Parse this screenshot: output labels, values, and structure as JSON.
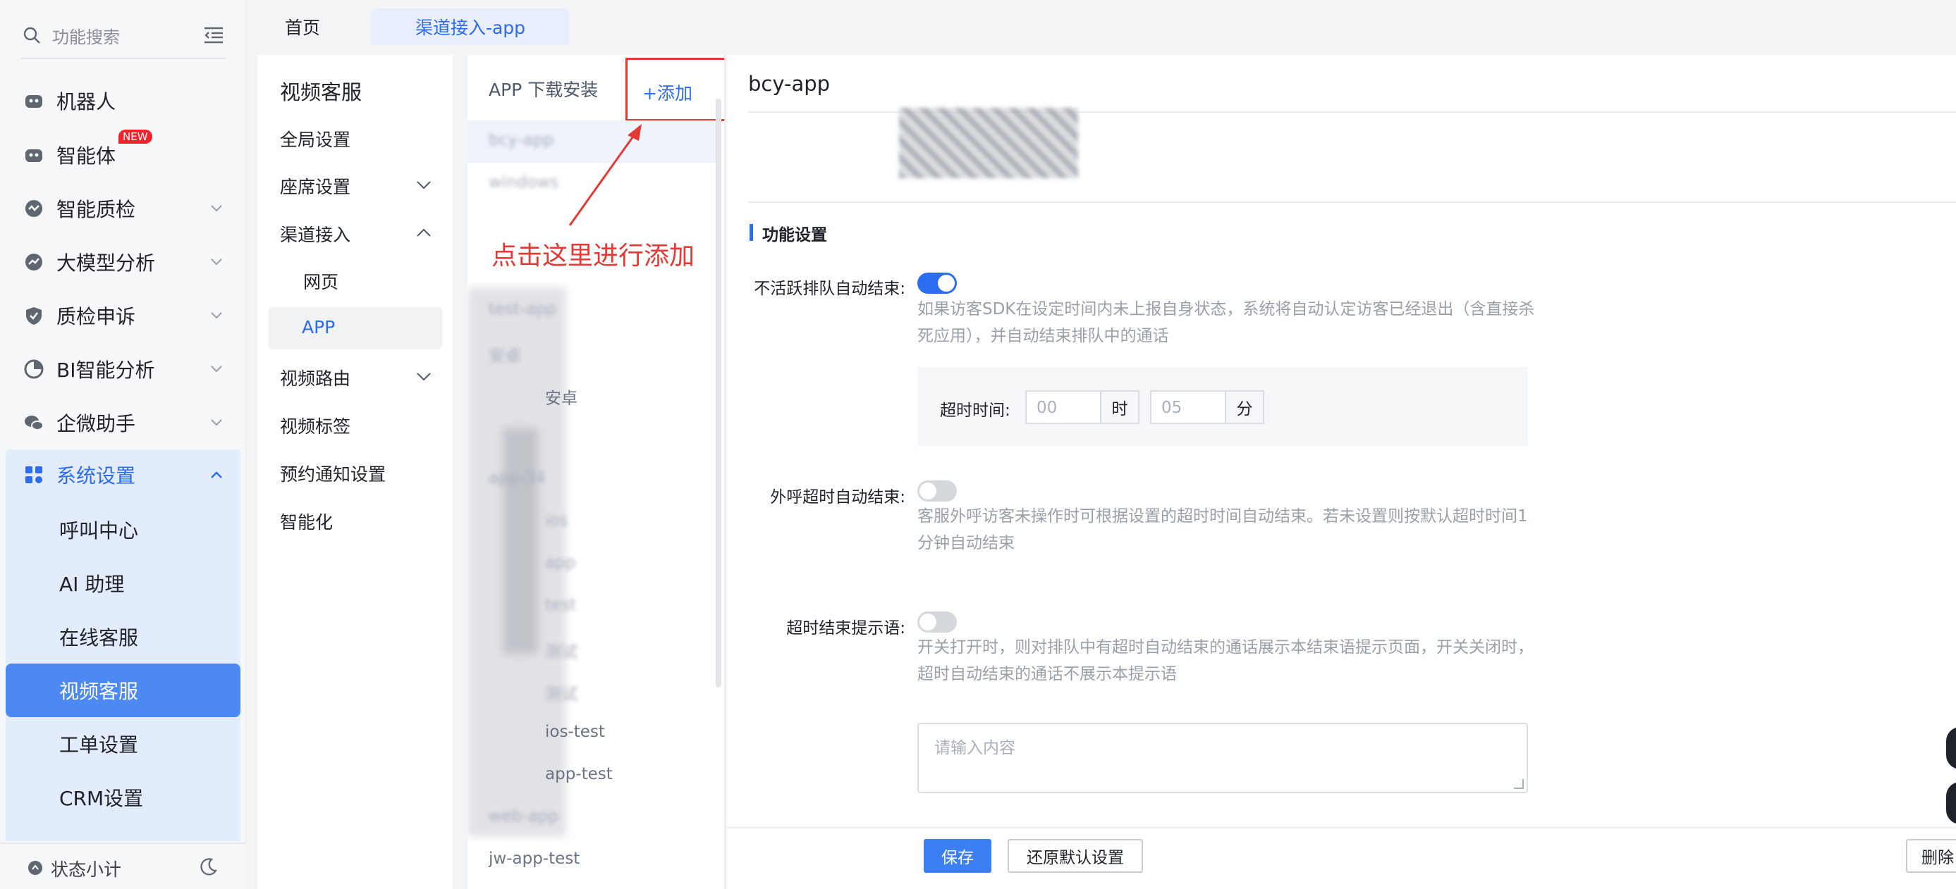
{
  "sidebar": {
    "search_placeholder": "功能搜索",
    "items": [
      {
        "label": "机器人",
        "icon": "robot-icon"
      },
      {
        "label": "智能体",
        "icon": "agent-icon",
        "badge": "NEW"
      },
      {
        "label": "智能质检",
        "icon": "quality-check-icon"
      },
      {
        "label": "大模型分析",
        "icon": "model-analysis-icon"
      },
      {
        "label": "质检申诉",
        "icon": "shield-icon"
      },
      {
        "label": "BI智能分析",
        "icon": "pie-icon"
      },
      {
        "label": "企微助手",
        "icon": "chat-icon"
      },
      {
        "label": "系统设置",
        "icon": "grid-icon"
      }
    ],
    "sub_items": [
      "呼叫中心",
      "AI 助理",
      "在线客服",
      "视频客服",
      "工单设置",
      "CRM设置"
    ],
    "active_sub": "视频客服",
    "footer_label": "状态小计"
  },
  "tabs": [
    "首页",
    "渠道接入-app"
  ],
  "menu": {
    "title": "视频客服",
    "items": [
      "全局设置",
      "座席设置",
      "渠道接入",
      "网页",
      "APP",
      "视频路由",
      "视频标签",
      "预约通知设置",
      "智能化"
    ]
  },
  "list": {
    "title": "APP 下载安装",
    "add_label": "+添加",
    "rows": [
      "bcy-app",
      "windows",
      "",
      "",
      "test-app",
      "安卓",
      "安卓",
      "",
      "app-34",
      "ios",
      "app",
      "test",
      "测试",
      "测试",
      "ios-test",
      "app-test",
      "web-app",
      "jw-app-test"
    ]
  },
  "detail": {
    "title": "bcy-app",
    "section": "功能设置",
    "inactive_label": "不活跃排队自动结束:",
    "inactive_desc": "如果访客SDK在设定时间内未上报自身状态，系统将自动认定访客已经退出（含直接杀死应用），并自动结束排队中的通话",
    "timeout_label": "超时时间:",
    "hours_placeholder": "00",
    "hours_unit": "时",
    "minutes_placeholder": "05",
    "minutes_unit": "分",
    "outbound_label": "外呼超时自动结束:",
    "outbound_desc": "客服外呼访客未操作时可根据设置的超时时间自动结束。若未设置则按默认超时时间1分钟自动结束",
    "prompt_label": "超时结束提示语:",
    "prompt_desc": "开关打开时，则对排队中有超时自动结束的通话展示本结束语提示页面，开关关闭时，超时自动结束的通话不展示本提示语",
    "textarea_placeholder": "请输入内容",
    "save": "保存",
    "reset": "还原默认设置",
    "delete": "删除"
  },
  "annotation": "点击这里进行添加"
}
